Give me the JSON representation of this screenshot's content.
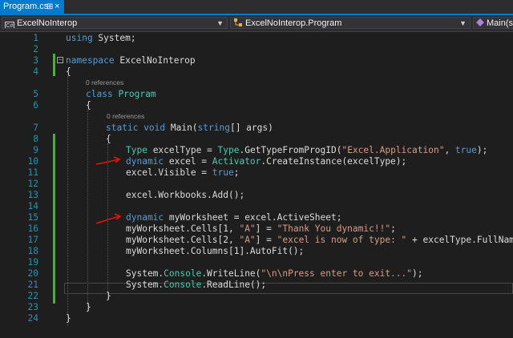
{
  "tab": {
    "title": "Program.cs",
    "pin_glyph": "⊞",
    "close_glyph": "×"
  },
  "navbar": {
    "project": "ExcelNoInterop",
    "class": "ExcelNoInterop.Program",
    "member": "Main(strin"
  },
  "codelens": {
    "class_refs": "0 references",
    "main_refs": "0 references"
  },
  "lines": [
    {
      "n": "1",
      "segs": [
        [
          "kw",
          "using"
        ],
        [
          "id",
          " System;"
        ]
      ]
    },
    {
      "n": "2",
      "segs": []
    },
    {
      "n": "3",
      "segs": [
        [
          "kw",
          "namespace"
        ],
        [
          "id",
          " ExcelNoInterop"
        ]
      ]
    },
    {
      "n": "4",
      "segs": [
        [
          "id",
          "{"
        ]
      ]
    },
    {
      "n": "5",
      "segs": [
        [
          "kw",
          "class"
        ],
        [
          "id",
          " "
        ],
        [
          "ty",
          "Program"
        ]
      ]
    },
    {
      "n": "6",
      "segs": [
        [
          "id",
          "{"
        ]
      ]
    },
    {
      "n": "7",
      "segs": [
        [
          "kw",
          "static"
        ],
        [
          "id",
          " "
        ],
        [
          "kw",
          "void"
        ],
        [
          "id",
          " Main("
        ],
        [
          "kw",
          "string"
        ],
        [
          "id",
          "[] args)"
        ]
      ]
    },
    {
      "n": "8",
      "segs": [
        [
          "id",
          "{"
        ]
      ]
    },
    {
      "n": "9",
      "segs": [
        [
          "ty",
          "Type"
        ],
        [
          "id",
          " excelType = "
        ],
        [
          "ty",
          "Type"
        ],
        [
          "id",
          ".GetTypeFromProgID("
        ],
        [
          "st",
          "\"Excel.Application\""
        ],
        [
          "id",
          ", "
        ],
        [
          "kw",
          "true"
        ],
        [
          "id",
          ");"
        ]
      ]
    },
    {
      "n": "10",
      "segs": [
        [
          "kw",
          "dynamic"
        ],
        [
          "id",
          " excel = "
        ],
        [
          "ty",
          "Activator"
        ],
        [
          "id",
          ".CreateInstance(excelType);"
        ]
      ]
    },
    {
      "n": "11",
      "segs": [
        [
          "id",
          "excel.Visible = "
        ],
        [
          "kw",
          "true"
        ],
        [
          "id",
          ";"
        ]
      ]
    },
    {
      "n": "12",
      "segs": []
    },
    {
      "n": "13",
      "segs": [
        [
          "id",
          "excel.Workbooks.Add();"
        ]
      ]
    },
    {
      "n": "14",
      "segs": []
    },
    {
      "n": "15",
      "segs": [
        [
          "kw",
          "dynamic"
        ],
        [
          "id",
          " myWorksheet = excel.ActiveSheet;"
        ]
      ]
    },
    {
      "n": "16",
      "segs": [
        [
          "id",
          "myWorksheet.Cells[1, "
        ],
        [
          "st",
          "\"A\""
        ],
        [
          "id",
          "] = "
        ],
        [
          "st",
          "\"Thank You dynamic!!\""
        ],
        [
          "id",
          ";"
        ]
      ]
    },
    {
      "n": "17",
      "segs": [
        [
          "id",
          "myWorksheet.Cells[2, "
        ],
        [
          "st",
          "\"A\""
        ],
        [
          "id",
          "] = "
        ],
        [
          "st",
          "\"excel is now of type: \""
        ],
        [
          "id",
          " + excelType.FullName;"
        ]
      ]
    },
    {
      "n": "18",
      "segs": [
        [
          "id",
          "myWorksheet.Columns[1].AutoFit();"
        ]
      ]
    },
    {
      "n": "19",
      "segs": []
    },
    {
      "n": "20",
      "segs": [
        [
          "id",
          "System."
        ],
        [
          "ty",
          "Console"
        ],
        [
          "id",
          ".WriteLine("
        ],
        [
          "st",
          "\"\\n\\nPress enter to exit...\""
        ],
        [
          "id",
          ");"
        ]
      ]
    },
    {
      "n": "21",
      "segs": [
        [
          "id",
          "System."
        ],
        [
          "ty",
          "Console"
        ],
        [
          "id",
          ".ReadLine();"
        ]
      ]
    },
    {
      "n": "22",
      "segs": [
        [
          "id",
          "}"
        ]
      ]
    },
    {
      "n": "23",
      "segs": [
        [
          "id",
          "}"
        ]
      ]
    },
    {
      "n": "24",
      "segs": [
        [
          "id",
          "}"
        ]
      ]
    }
  ],
  "colors": {
    "keyword": "#569cd6",
    "type": "#4ec9b0",
    "string": "#d69d85",
    "line_number": "#2b91af",
    "change_bar": "#57a64a",
    "annotation_arrow": "#e51400"
  }
}
